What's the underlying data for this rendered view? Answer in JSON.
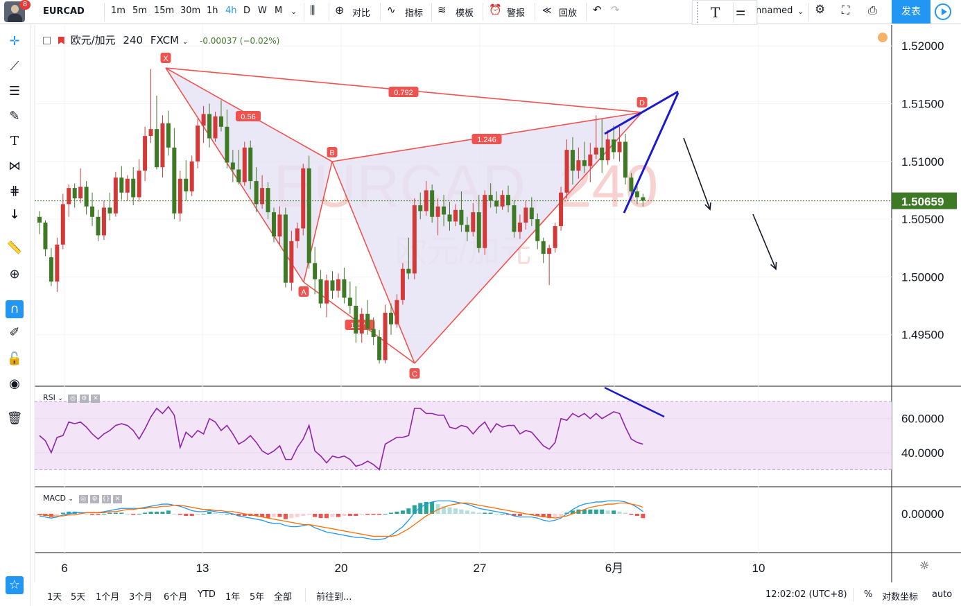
{
  "toolbar": {
    "notification_count": "8",
    "symbol": "EURCAD",
    "intervals": [
      "1m",
      "5m",
      "15m",
      "30m",
      "1h",
      "4h",
      "D",
      "W",
      "M"
    ],
    "active_interval": "4h",
    "compare_label": "对比",
    "indicators_label": "指标",
    "templates_label": "模板",
    "alert_label": "警报",
    "replay_label": "回放",
    "layout_name": "nnamed",
    "publish_label": "发表"
  },
  "legend": {
    "title": "欧元/加元",
    "interval": "240",
    "source": "FXCM",
    "change": "-0.00037 (−0.02%)"
  },
  "watermark": {
    "line1": "EURCAD, 240",
    "line2": "欧元/加元"
  },
  "colors": {
    "up": "#d23a3a",
    "down": "#3e7a25",
    "pattern": "#ef5350",
    "pattern_fill": "#e6e3f4",
    "rsi_line": "#8e24aa",
    "rsi_band": "#f3e5f7",
    "macd_line": "#2196f3",
    "signal_line": "#ff6d00",
    "price_tag": "#3e7a25",
    "accent": "#2196f3",
    "annotation_blue": "#1a1acc"
  },
  "chart_data": [
    {
      "type": "candlestick",
      "title": "欧元/加元",
      "price_scale": [
        1.49,
        1.5225
      ],
      "y_ticks": [
        "1.52000",
        "1.51500",
        "1.51000",
        "1.50500",
        "1.50000",
        "1.49500"
      ],
      "x_ticks": [
        "6",
        "13",
        "20",
        "27",
        "6月",
        "10"
      ],
      "last_price": "1.50659",
      "candles": [
        [
          1.5052,
          1.5057,
          1.5037,
          1.5047
        ],
        [
          1.5047,
          1.5049,
          1.5018,
          1.5024
        ],
        [
          1.5017,
          1.5025,
          1.4992,
          1.4996
        ],
        [
          1.4996,
          1.5034,
          1.4987,
          1.5028
        ],
        [
          1.5028,
          1.5072,
          1.5024,
          1.5063
        ],
        [
          1.5063,
          1.508,
          1.5052,
          1.5077
        ],
        [
          1.5077,
          1.5081,
          1.506,
          1.5068
        ],
        [
          1.5068,
          1.5094,
          1.5064,
          1.5078
        ],
        [
          1.5078,
          1.5083,
          1.5054,
          1.5061
        ],
        [
          1.5061,
          1.5073,
          1.5044,
          1.5052
        ],
        [
          1.5052,
          1.5058,
          1.5031,
          1.5036
        ],
        [
          1.5036,
          1.5066,
          1.5032,
          1.506
        ],
        [
          1.506,
          1.5073,
          1.5049,
          1.5055
        ],
        [
          1.5055,
          1.5091,
          1.5052,
          1.5086
        ],
        [
          1.5086,
          1.5096,
          1.5067,
          1.5073
        ],
        [
          1.5073,
          1.5088,
          1.5066,
          1.5085
        ],
        [
          1.5085,
          1.5095,
          1.5062,
          1.5069
        ],
        [
          1.5069,
          1.5102,
          1.5065,
          1.5092
        ],
        [
          1.5092,
          1.513,
          1.5083,
          1.5122
        ],
        [
          1.5122,
          1.518,
          1.5116,
          1.5128
        ],
        [
          1.5128,
          1.5157,
          1.5093,
          1.5095
        ],
        [
          1.5095,
          1.514,
          1.5086,
          1.5133
        ],
        [
          1.5133,
          1.5144,
          1.5105,
          1.5112
        ],
        [
          1.5112,
          1.5129,
          1.505,
          1.5055
        ],
        [
          1.5055,
          1.5092,
          1.5048,
          1.5085
        ],
        [
          1.5085,
          1.5101,
          1.5066,
          1.5074
        ],
        [
          1.5074,
          1.5105,
          1.507,
          1.51
        ],
        [
          1.51,
          1.5137,
          1.5094,
          1.5131
        ],
        [
          1.5131,
          1.5148,
          1.5116,
          1.5141
        ],
        [
          1.5141,
          1.515,
          1.5112,
          1.512
        ],
        [
          1.512,
          1.5143,
          1.5117,
          1.5139
        ],
        [
          1.5139,
          1.5153,
          1.5126,
          1.513
        ],
        [
          1.513,
          1.5145,
          1.5094,
          1.5099
        ],
        [
          1.5099,
          1.511,
          1.5082,
          1.5093
        ],
        [
          1.5093,
          1.511,
          1.508,
          1.5082
        ],
        [
          1.5082,
          1.5117,
          1.5079,
          1.5112
        ],
        [
          1.5112,
          1.5118,
          1.5076,
          1.5083
        ],
        [
          1.5083,
          1.5095,
          1.5056,
          1.5063
        ],
        [
          1.5063,
          1.5088,
          1.5059,
          1.5077
        ],
        [
          1.5077,
          1.5082,
          1.505,
          1.5056
        ],
        [
          1.5056,
          1.506,
          1.503,
          1.5035
        ],
        [
          1.5035,
          1.5061,
          1.5028,
          1.5054
        ],
        [
          1.5054,
          1.506,
          1.4991,
          1.4995
        ],
        [
          1.4995,
          1.504,
          1.4988,
          1.5031
        ],
        [
          1.5031,
          1.5047,
          1.5025,
          1.5042
        ],
        [
          1.5042,
          1.5098,
          1.5036,
          1.5094
        ],
        [
          1.5094,
          1.5105,
          1.5007,
          1.5012
        ],
        [
          1.5012,
          1.5026,
          1.4985,
          1.4998
        ],
        [
          1.4998,
          1.5006,
          1.4973,
          1.4977
        ],
        [
          1.4977,
          1.5002,
          1.4965,
          1.4997
        ],
        [
          1.4997,
          1.5005,
          1.4981,
          1.4988
        ],
        [
          1.4988,
          1.5003,
          1.4982,
          1.4998
        ],
        [
          1.4998,
          1.5008,
          1.4977,
          1.4982
        ],
        [
          1.4982,
          1.4996,
          1.4968,
          1.4975
        ],
        [
          1.4975,
          1.4992,
          1.4943,
          1.4951
        ],
        [
          1.4951,
          1.4973,
          1.4943,
          1.4968
        ],
        [
          1.4968,
          1.498,
          1.495,
          1.4955
        ],
        [
          1.4955,
          1.4965,
          1.4941,
          1.4948
        ],
        [
          1.4948,
          1.4954,
          1.4925,
          1.4928
        ],
        [
          1.4928,
          1.4976,
          1.4925,
          1.4969
        ],
        [
          1.4969,
          1.4977,
          1.495,
          1.4959
        ],
        [
          1.4959,
          1.4985,
          1.4956,
          1.498
        ],
        [
          1.498,
          1.5012,
          1.4976,
          1.5007
        ],
        [
          1.5007,
          1.5034,
          1.4998,
          1.5003
        ],
        [
          1.5003,
          1.5068,
          1.4998,
          1.5062
        ],
        [
          1.5062,
          1.5073,
          1.505,
          1.5057
        ],
        [
          1.5057,
          1.5083,
          1.5053,
          1.5075
        ],
        [
          1.5075,
          1.508,
          1.5047,
          1.5052
        ],
        [
          1.5052,
          1.5068,
          1.5036,
          1.5061
        ],
        [
          1.5061,
          1.5071,
          1.5044,
          1.5054
        ],
        [
          1.5054,
          1.5065,
          1.504,
          1.5048
        ],
        [
          1.5048,
          1.5063,
          1.5044,
          1.5058
        ],
        [
          1.5058,
          1.5074,
          1.5039,
          1.5045
        ],
        [
          1.5045,
          1.5052,
          1.5031,
          1.5039
        ],
        [
          1.5039,
          1.5064,
          1.5035,
          1.5056
        ],
        [
          1.5056,
          1.5071,
          1.5021,
          1.5025
        ],
        [
          1.5025,
          1.5075,
          1.5019,
          1.5071
        ],
        [
          1.5071,
          1.5081,
          1.506,
          1.5066
        ],
        [
          1.5066,
          1.5074,
          1.5055,
          1.5061
        ],
        [
          1.5061,
          1.5075,
          1.5058,
          1.5071
        ],
        [
          1.5071,
          1.5079,
          1.5056,
          1.5062
        ],
        [
          1.5062,
          1.5066,
          1.5034,
          1.5039
        ],
        [
          1.5039,
          1.5054,
          1.5033,
          1.5047
        ],
        [
          1.5047,
          1.5066,
          1.5041,
          1.506
        ],
        [
          1.506,
          1.5069,
          1.5044,
          1.505
        ],
        [
          1.505,
          1.5055,
          1.5024,
          1.5031
        ],
        [
          1.5031,
          1.5034,
          1.5012,
          1.502
        ],
        [
          1.502,
          1.5028,
          1.4993,
          1.5025
        ],
        [
          1.5025,
          1.5047,
          1.5021,
          1.5044
        ],
        [
          1.5044,
          1.5078,
          1.504,
          1.5073
        ],
        [
          1.5073,
          1.5119,
          1.5068,
          1.511
        ],
        [
          1.511,
          1.5121,
          1.508,
          1.5092
        ],
        [
          1.5092,
          1.5112,
          1.5085,
          1.5101
        ],
        [
          1.5101,
          1.5117,
          1.509,
          1.5096
        ],
        [
          1.5096,
          1.5116,
          1.5082,
          1.5106
        ],
        [
          1.5106,
          1.514,
          1.5102,
          1.5112
        ],
        [
          1.5112,
          1.5137,
          1.509,
          1.5101
        ],
        [
          1.5101,
          1.5127,
          1.5097,
          1.5119
        ],
        [
          1.5119,
          1.5131,
          1.5102,
          1.5108
        ],
        [
          1.5108,
          1.513,
          1.51,
          1.5117
        ],
        [
          1.5117,
          1.5124,
          1.508,
          1.5086
        ],
        [
          1.5086,
          1.509,
          1.5068,
          1.5074
        ],
        [
          1.5074,
          1.5079,
          1.5063,
          1.5069
        ],
        [
          1.5069,
          1.5072,
          1.5061,
          1.5066
        ]
      ]
    },
    {
      "type": "line",
      "title": "RSI",
      "y_ticks": [
        "60.0000",
        "40.0000"
      ],
      "band": [
        30,
        70
      ],
      "y_range": [
        22,
        77
      ],
      "values": [
        50,
        47,
        40,
        49,
        50,
        58,
        57,
        58,
        55,
        51,
        48,
        51,
        53,
        56,
        57,
        56,
        53,
        48,
        54,
        61,
        66,
        63,
        67,
        62,
        43,
        52,
        49,
        53,
        51,
        60,
        58,
        53,
        56,
        51,
        45,
        47,
        50,
        46,
        41,
        39,
        41,
        44,
        36,
        36,
        43,
        48,
        56,
        41,
        38,
        34,
        38,
        37,
        38,
        36,
        32,
        33,
        35,
        33,
        30,
        45,
        47,
        49,
        49,
        50,
        66,
        66,
        63,
        63,
        62,
        62,
        55,
        54,
        56,
        55,
        51,
        55,
        58,
        52,
        57,
        55,
        56,
        56,
        51,
        53,
        52,
        48,
        44,
        42,
        46,
        60,
        59,
        63,
        61,
        63,
        60,
        63,
        60,
        62,
        64,
        63,
        55,
        48,
        46,
        45
      ]
    },
    {
      "type": "bar+line",
      "title": "MACD",
      "y_ticks": [
        "0.00000"
      ],
      "histogram": [
        -1,
        -2,
        -3,
        -1,
        1,
        2,
        2,
        1,
        0,
        -1,
        -1,
        0,
        1,
        1,
        1,
        0,
        -1,
        0,
        1,
        2,
        2,
        2,
        3,
        0,
        -1,
        -2,
        -2,
        -1,
        0,
        2,
        1,
        0,
        0,
        -1,
        -2,
        -2,
        -2,
        -2,
        -3,
        -4,
        -3,
        -3,
        -5,
        -4,
        -3,
        -2,
        -1,
        -3,
        -4,
        -4,
        -3,
        -3,
        -2,
        -2,
        -2,
        -1,
        -1,
        -1,
        -1,
        0,
        1,
        2,
        3,
        5,
        8,
        10,
        11,
        11,
        9,
        7,
        6,
        5,
        4,
        3,
        2,
        1,
        1,
        1,
        0,
        0,
        -1,
        -2,
        -2,
        -1,
        -1,
        -2,
        -3,
        -4,
        -3,
        -2,
        1,
        3,
        4,
        4,
        4,
        4,
        4,
        3,
        3,
        2,
        1,
        -1,
        -2,
        -4
      ],
      "macd_line": [
        -2,
        -3,
        -4,
        -3,
        -1,
        0,
        1,
        1,
        1,
        1,
        1,
        2,
        3,
        4,
        5,
        5,
        5,
        5,
        6,
        7,
        8,
        9,
        9,
        8,
        7,
        5,
        3,
        2,
        2,
        3,
        2,
        1,
        1,
        0,
        -2,
        -3,
        -4,
        -5,
        -6,
        -8,
        -9,
        -9,
        -11,
        -12,
        -12,
        -11,
        -10,
        -13,
        -15,
        -17,
        -18,
        -19,
        -20,
        -21,
        -22,
        -22,
        -23,
        -24,
        -24,
        -23,
        -20,
        -16,
        -12,
        -6,
        1,
        6,
        9,
        11,
        12,
        12,
        12,
        11,
        10,
        9,
        7,
        5,
        4,
        3,
        2,
        1,
        0,
        -2,
        -3,
        -3,
        -3,
        -4,
        -6,
        -7,
        -6,
        -4,
        0,
        4,
        7,
        9,
        10,
        11,
        11,
        12,
        12,
        12,
        11,
        9,
        6,
        2
      ],
      "signal_line": [
        -1,
        -1,
        -2,
        -2,
        -2,
        -1,
        -1,
        0,
        1,
        1,
        1,
        1,
        2,
        2,
        3,
        4,
        4,
        5,
        5,
        6,
        6,
        7,
        7,
        8,
        8,
        7,
        6,
        5,
        4,
        4,
        3,
        3,
        2,
        2,
        1,
        0,
        -1,
        -2,
        -3,
        -4,
        -5,
        -6,
        -7,
        -8,
        -9,
        -10,
        -10,
        -11,
        -12,
        -13,
        -14,
        -15,
        -16,
        -17,
        -18,
        -19,
        -20,
        -21,
        -21,
        -21,
        -21,
        -20,
        -17,
        -14,
        -10,
        -6,
        -2,
        1,
        4,
        6,
        8,
        9,
        10,
        10,
        9,
        8,
        7,
        6,
        5,
        4,
        3,
        2,
        1,
        0,
        -1,
        -2,
        -3,
        -3,
        -4,
        -3,
        -2,
        0,
        2,
        4,
        6,
        7,
        8,
        9,
        9,
        10,
        10,
        9,
        8,
        6
      ]
    }
  ],
  "pattern": {
    "points": {
      "X": "X",
      "A": "A",
      "B": "B",
      "C": "C",
      "D": "D"
    },
    "ratios": {
      "xb": "0.56",
      "ac": "1.679",
      "bd": "1.246",
      "xd": "0.792"
    }
  },
  "bottombar": {
    "ranges": [
      "1天",
      "5天",
      "1个月",
      "3个月",
      "6个月",
      "YTD",
      "1年",
      "5年",
      "全部"
    ],
    "goto": "前往到...",
    "time": "12:02:02 (UTC+8)",
    "percent": "%",
    "log": "对数坐标",
    "auto": "auto"
  }
}
